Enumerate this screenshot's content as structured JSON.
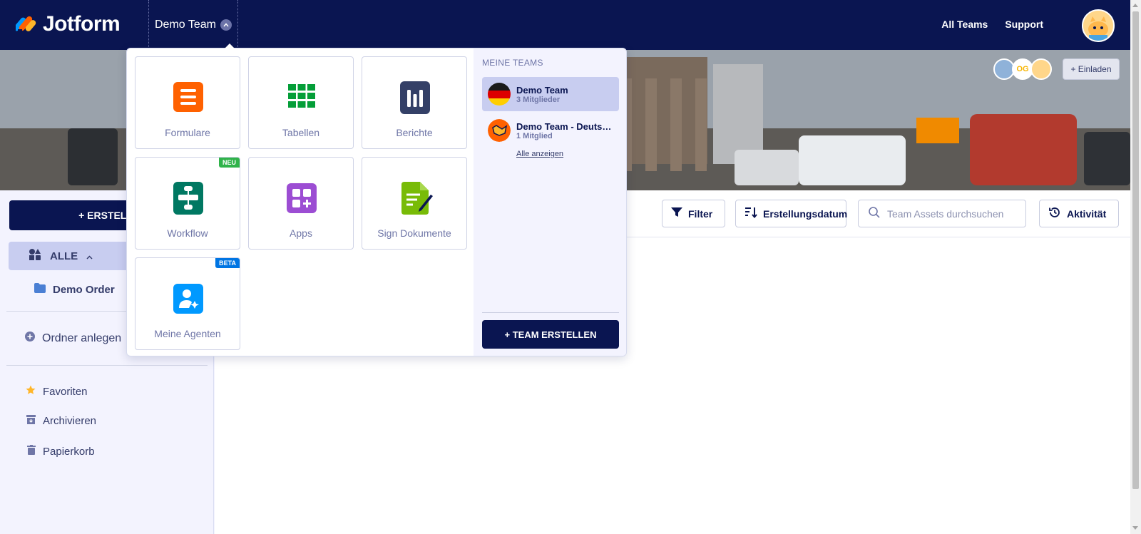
{
  "app": {
    "logo_text": "Jotform"
  },
  "nav": {
    "team_name": "Demo Team",
    "links": [
      "All Teams",
      "Support"
    ]
  },
  "banner": {
    "invite_label": "+ Einladen",
    "member_initials": "OG"
  },
  "sidebar": {
    "create_label": "+ ERSTELL",
    "all_label": "ALLE",
    "folder_label": "Demo Order",
    "new_folder_label": "Ordner anlegen",
    "favorites_label": "Favoriten",
    "archive_label": "Archivieren",
    "trash_label": "Papierkorb"
  },
  "toolbar": {
    "filter_label": "Filter",
    "sort_label": "Erstellungsdatum",
    "search_placeholder": "Team Assets durchsuchen",
    "activity_label": "Aktivität"
  },
  "dropdown": {
    "tiles": [
      {
        "label": "Formulare",
        "color": "#ff6100",
        "icon": "forms-icon"
      },
      {
        "label": "Tabellen",
        "color": "#049e38",
        "icon": "tables-icon"
      },
      {
        "label": "Berichte",
        "color": "#344067",
        "icon": "reports-icon"
      },
      {
        "label": "Workflow",
        "color": "#007862",
        "icon": "workflow-icon",
        "badge": "NEU"
      },
      {
        "label": "Apps",
        "color": "#9c4dd3",
        "icon": "apps-icon"
      },
      {
        "label": "Sign Dokumente",
        "color": "#78bb07",
        "icon": "sign-icon"
      },
      {
        "label": "Meine Agenten",
        "color": "#0099ff",
        "icon": "agents-icon",
        "badge": "BETA"
      }
    ],
    "teams_heading": "MEINE TEAMS",
    "teams": [
      {
        "name": "Demo Team",
        "meta": "3 Mitglieder"
      },
      {
        "name": "Demo Team - Deutsch",
        "meta": "1 Mitglied"
      }
    ],
    "show_all_label": "Alle anzeigen",
    "create_team_label": "+ TEAM ERSTELLEN"
  }
}
